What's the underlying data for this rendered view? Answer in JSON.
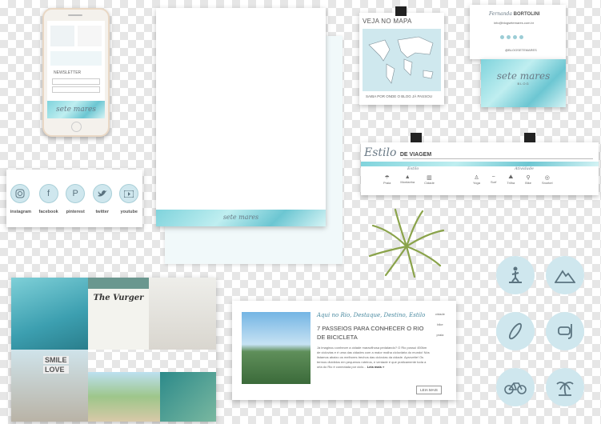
{
  "phone": {
    "newsletter_label": "NEWSLETTER",
    "brand_line1": "sete mares"
  },
  "stationery": {
    "brand_line1": "sete mares"
  },
  "map_card": {
    "title": "VEJA NO MAPA",
    "caption": "SAIBA POR ONDE O BLOG JÁ PASSOU"
  },
  "business_card": {
    "name_first": "Fernanda",
    "name_last": "BORTOLINI",
    "email": "info@blogsetemares.com.br",
    "handle": "@BLOGSETEMARES",
    "brand": "sete mares",
    "brand_sub": "BLOG"
  },
  "social": {
    "items": [
      {
        "label": "instagram",
        "icon": "instagram-icon"
      },
      {
        "label": "facebook",
        "icon": "facebook-icon"
      },
      {
        "label": "pinterest",
        "icon": "pinterest-icon"
      },
      {
        "label": "twitter",
        "icon": "twitter-icon"
      },
      {
        "label": "youtube",
        "icon": "youtube-icon"
      }
    ]
  },
  "style_banner": {
    "title_script": "Estilo",
    "title_bold": "DE VIAGEM",
    "left_group": "Estilo",
    "right_group": "Atividade",
    "left_items": [
      "Praia",
      "Montanha",
      "Cidade"
    ],
    "right_items": [
      "Yoga",
      "Surf",
      "Trilha",
      "Bike",
      "Snorkel"
    ]
  },
  "moodboard": {
    "caption": "The Vurger",
    "words": [
      "SMILE",
      "LOVE"
    ]
  },
  "blog_post": {
    "categories": "Aqui no Rio, Destaque, Destino, Estilo",
    "title": "7 PASSEIOS PARA CONHECER O RIO DE BICICLETA",
    "excerpt": "Já imaginou conhecer a cidade maravilhosa pedalando? O Rio possui 450km de ciclovias e é uma das cidades com a maior malha cicloviária do mundo! Nós listamos abaixo os melhores trechos das ciclovias da cidade. Aproveite! Os termos divididos em pequenos roteiros, e verdade é que praticamente toda a orla do Rio é conectada por ciclo...",
    "more_link": "Leia mais »",
    "button": "LEIA MAIS",
    "side_labels": [
      "cidade",
      "bike",
      "praia"
    ]
  },
  "icons": [
    "surfer-icon",
    "mountain-icon",
    "surfboard-icon",
    "snorkel-icon",
    "bike-icon",
    "palm-tree-icon"
  ]
}
